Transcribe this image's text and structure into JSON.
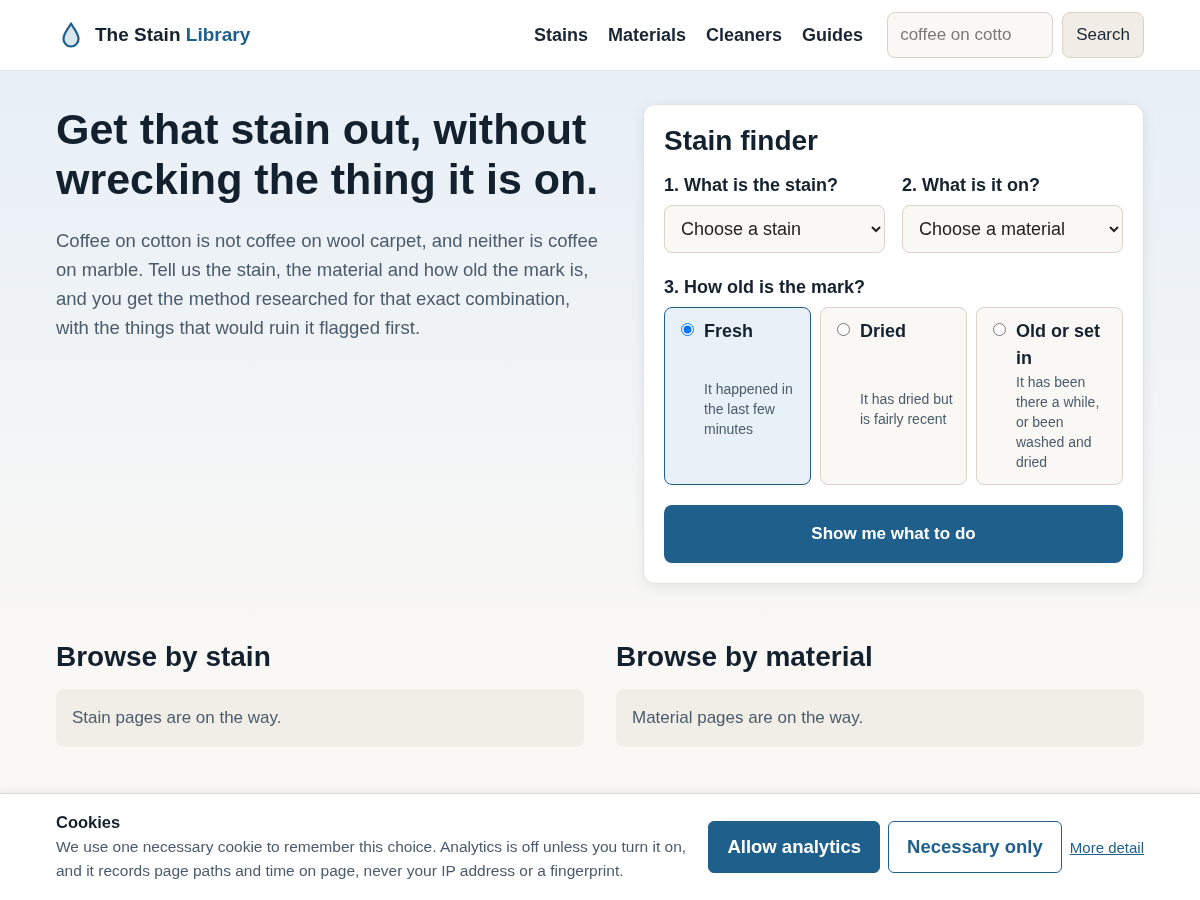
{
  "header": {
    "logo": {
      "name": "The Stain",
      "highlight": "Library"
    },
    "nav": [
      "Stains",
      "Materials",
      "Cleaners",
      "Guides"
    ],
    "search": {
      "placeholder": "coffee on cotto",
      "button": "Search"
    }
  },
  "hero": {
    "title": "Get that stain out, without wrecking the thing it is on.",
    "text": "Coffee on cotton is not coffee on wool carpet, and neither is coffee on marble. Tell us the stain, the material and how old the mark is, and you get the method researched for that exact combination, with the things that would ruin it flagged first."
  },
  "finder": {
    "title": "Stain finder",
    "stain_label": "1. What is the stain?",
    "stain_select": "Choose a stain",
    "material_label": "2. What is it on?",
    "material_select": "Choose a material",
    "age_label": "3. How old is the mark?",
    "age_options": [
      {
        "label": "Fresh",
        "description": "It happened in the last few minutes",
        "selected": true
      },
      {
        "label": "Dried",
        "description": "It has dried but is fairly recent",
        "selected": false
      },
      {
        "label": "Old or set in",
        "description": "It has been there a while, or been washed and dried",
        "selected": false
      }
    ],
    "submit": "Show me what to do"
  },
  "browse": [
    {
      "title": "Browse by stain",
      "text": "Stain pages are on the way."
    },
    {
      "title": "Browse by material",
      "text": "Material pages are on the way."
    }
  ],
  "cookie_banner": {
    "title": "Cookies",
    "text": "We use one necessary cookie to remember this choice. Analytics is off unless you turn it on, and it records page paths and time on page, never your IP address or a fingerprint.",
    "buttons": [
      {
        "label": "Allow analytics",
        "kind": "primary"
      },
      {
        "label": "Necessary only",
        "kind": "secondary"
      }
    ],
    "link": "More detail"
  }
}
